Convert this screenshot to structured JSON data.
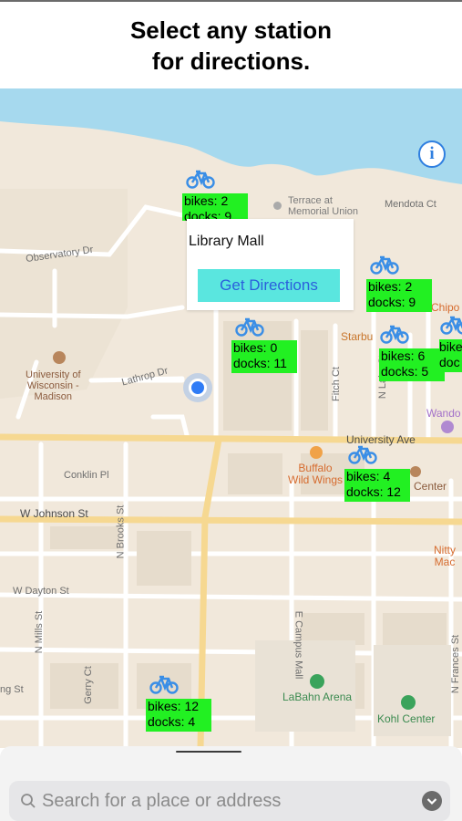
{
  "header": {
    "title": "Select any station\nfor directions."
  },
  "map": {
    "labels": {
      "terrace": "Terrace at\nMemorial Union",
      "mendota": "Mendota Ct",
      "observatory": "Observatory Dr",
      "university": "University of\nWisconsin -\nMadison",
      "lathrop": "Lathrop Dr",
      "fitch": "Fitch Ct",
      "lake": "N Lake St",
      "university_ave": "University Ave",
      "conklin": "Conklin Pl",
      "johnson": "W Johnson St",
      "brooks": "N Brooks St",
      "dayton": "W Dayton St",
      "mills": "N Mills St",
      "gerry": "Gerry Ct",
      "campus_mall": "E Campus Mall",
      "frances": "N Frances St",
      "ng_st": "ng St",
      "starbucks": "Starbu",
      "chipotle": "Chipo",
      "wando": "Wando",
      "buffalo": "Buffalo\nWild Wings",
      "center": "Center",
      "nitty": "Nitty\nMac",
      "labahn": "LaBahn Arena",
      "kohl": "Kohl Center"
    },
    "info_label": "i",
    "stations": [
      {
        "bikes": "bikes: 2",
        "docks": "docks: 9"
      },
      {
        "bikes": "bikes: 2",
        "docks": "docks: 9"
      },
      {
        "bikes": "bikes: 0",
        "docks": "docks: 11"
      },
      {
        "bikes": "bikes: 6",
        "docks": "docks: 5"
      },
      {
        "bikes": "bike",
        "docks": "doc"
      },
      {
        "bikes": "bikes: 4",
        "docks": "docks: 12"
      },
      {
        "bikes": "bikes: 12",
        "docks": "docks: 4"
      }
    ],
    "callout": {
      "title": "Library Mall",
      "button": "Get Directions"
    }
  },
  "search": {
    "placeholder": "Search for a place or address"
  },
  "colors": {
    "station_label": "#22f022",
    "accent": "#2f7cf6",
    "water": "#a6d9ee"
  }
}
